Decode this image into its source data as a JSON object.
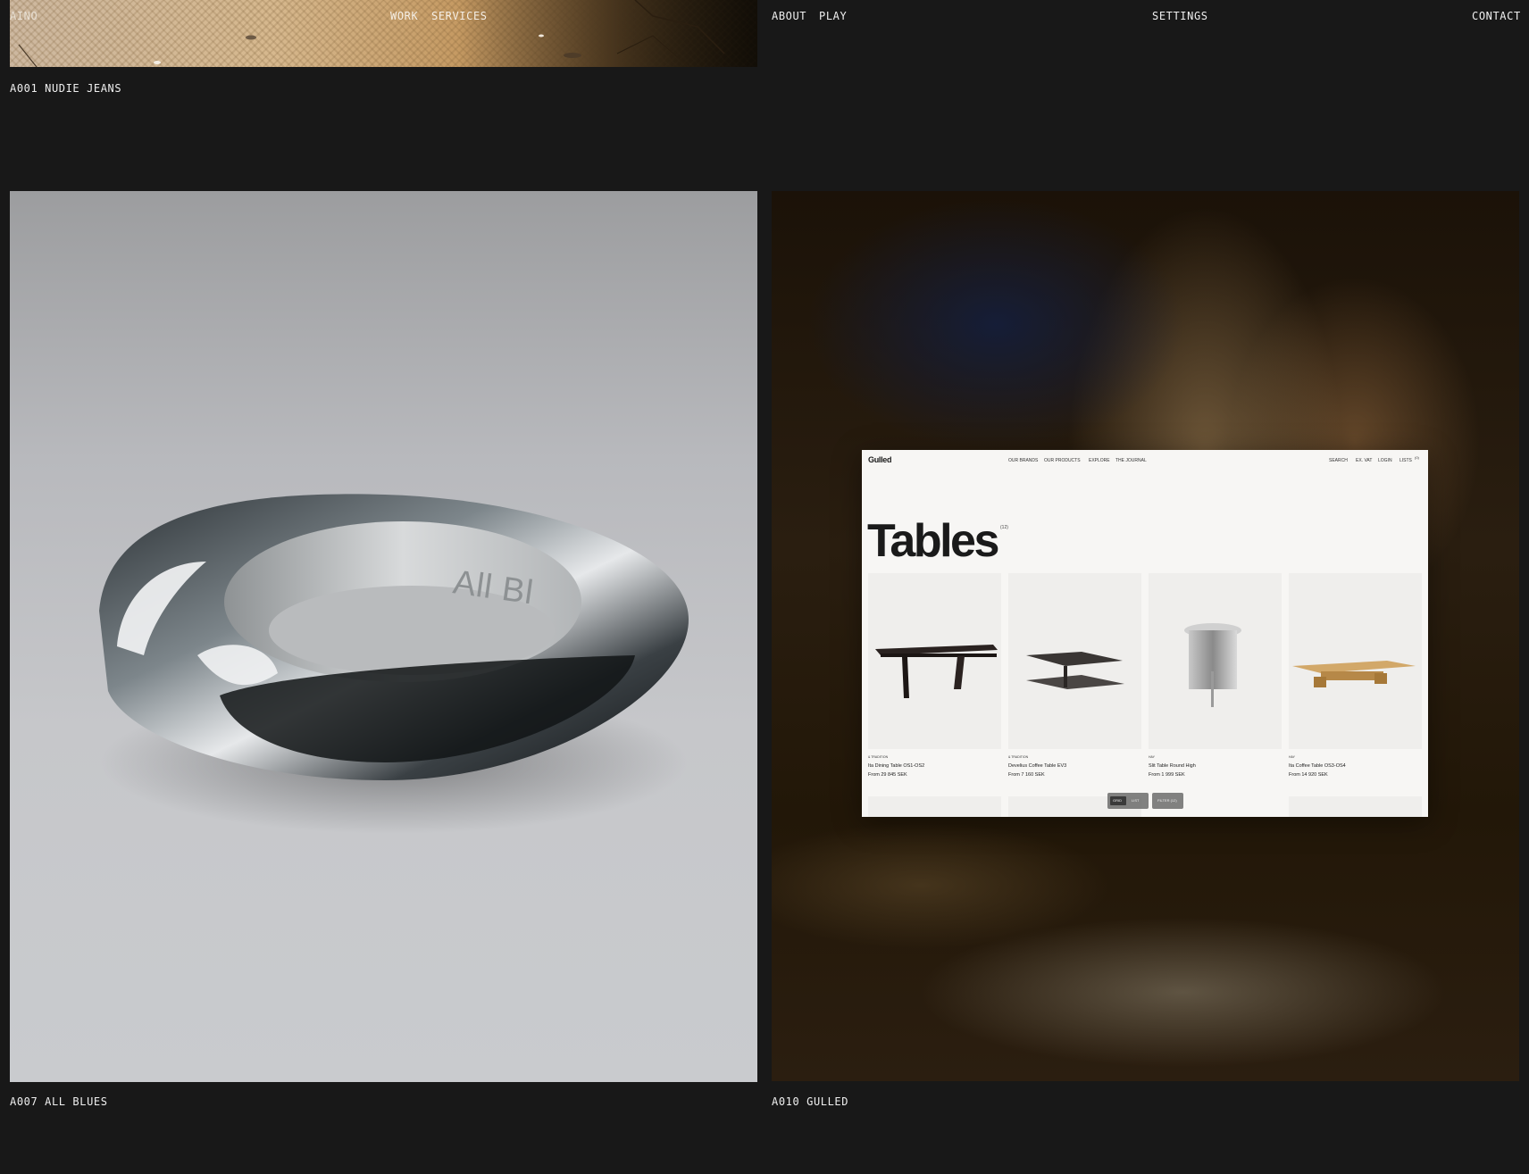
{
  "nav": {
    "left": "AINO",
    "work": "WORK",
    "services": "SERVICES",
    "about": "ABOUT",
    "play": "PLAY",
    "settings": "SETTINGS",
    "contact": "CONTACT"
  },
  "projects": [
    {
      "caption": "A001 NUDIE JEANS"
    },
    {
      "caption": "A007 ALL BLUES",
      "engraving": "All Bl"
    },
    {
      "caption": "A010 GULLED"
    }
  ],
  "gulled_site": {
    "logo": "Gulled",
    "nav": [
      "OUR BRANDS",
      "OUR PRODUCTS",
      "EXPLORE",
      "THE JOURNAL"
    ],
    "utility": [
      "SEARCH",
      "EX. VAT",
      "LOGIN",
      "LISTS"
    ],
    "lists_count": "(0)",
    "heading": "Tables",
    "count": "(12)",
    "products": [
      {
        "brand": "& TRADITION",
        "name": "Ita Dining Table OS1-OS2",
        "price": "From 29 845 SEK"
      },
      {
        "brand": "& TRADITION",
        "name": "Develius Coffee Table EV3",
        "price": "From 7 160 SEK"
      },
      {
        "brand": "HAY",
        "name": "Slit Table Round High",
        "price": "From 1 999 SEK"
      },
      {
        "brand": "HAY",
        "name": "Ita Coffee Table OS3-OS4",
        "price": "From 14 920 SEK"
      }
    ],
    "view_toggle": [
      "GRID",
      "LIST"
    ],
    "filter_label": "FILTER (12)"
  },
  "colors": {
    "background": "#181818",
    "text": "#efefef"
  }
}
